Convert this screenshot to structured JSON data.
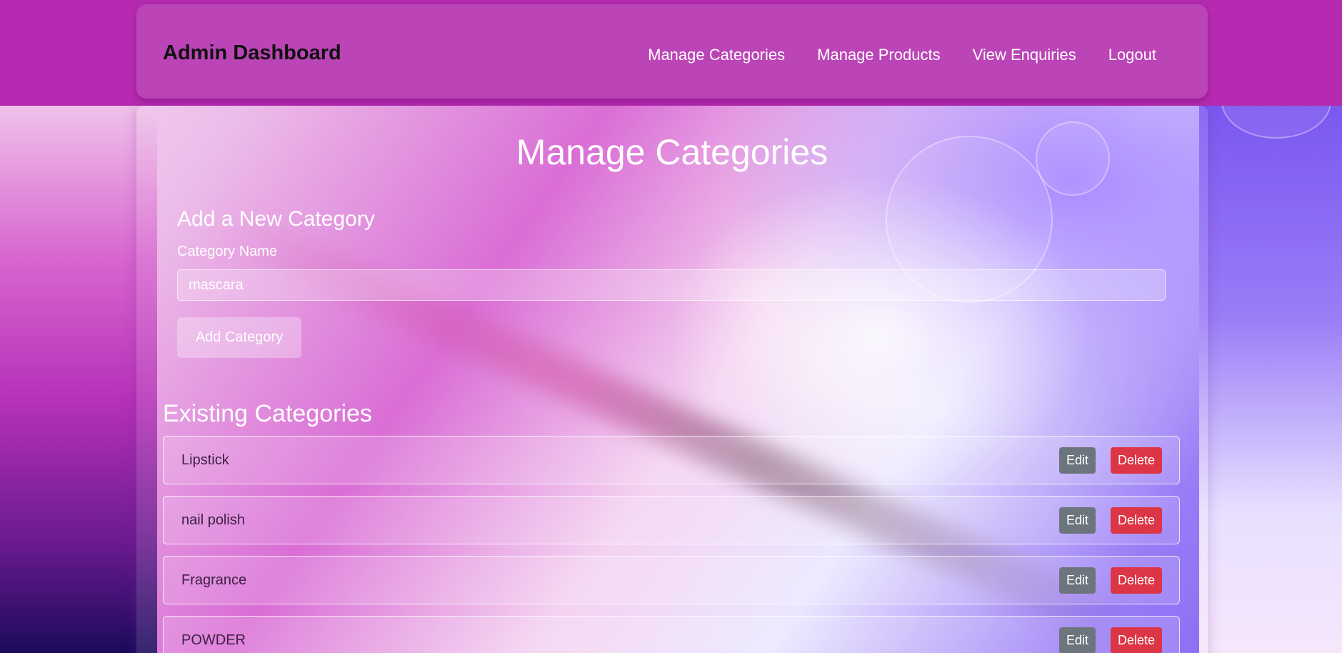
{
  "navbar": {
    "brand": "Admin Dashboard",
    "links": [
      "Manage Categories",
      "Manage Products",
      "View Enquiries",
      "Logout"
    ]
  },
  "main": {
    "title": "Manage Categories",
    "add_form": {
      "heading": "Add a New Category",
      "label": "Category Name",
      "input_value": "mascara",
      "submit_label": "Add Category"
    },
    "existing": {
      "heading": "Existing Categories",
      "edit_label": "Edit",
      "delete_label": "Delete",
      "items": [
        "Lipstick",
        "nail polish",
        "Fragrance",
        "POWDER"
      ]
    }
  },
  "colors": {
    "header": "#b52ab0",
    "navbar": "#bb44b6",
    "edit_button": "#6c757d",
    "delete_button": "#dc3545"
  }
}
